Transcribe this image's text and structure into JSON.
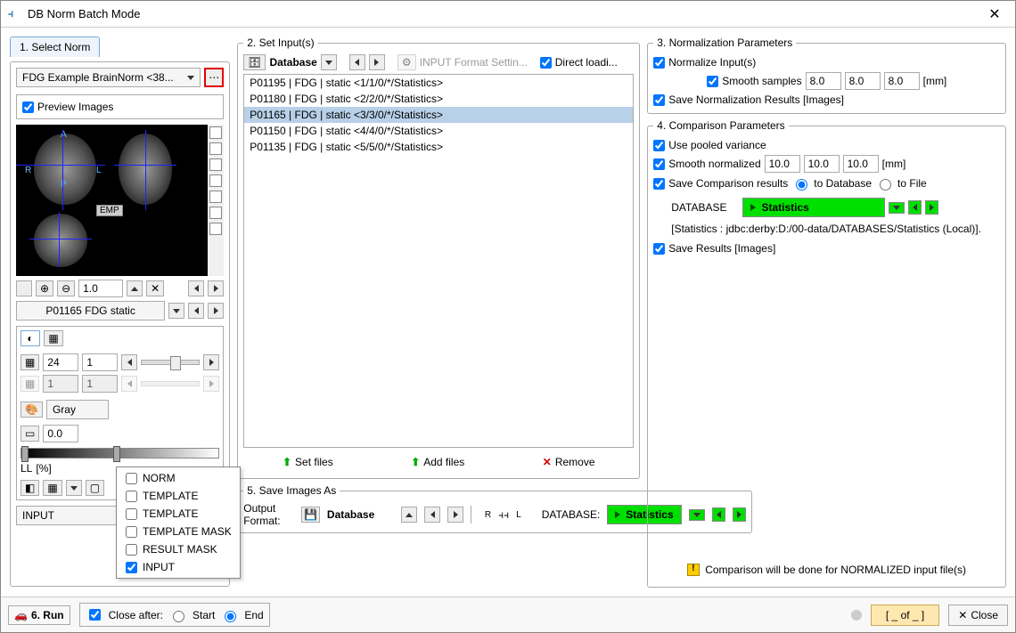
{
  "window": {
    "title": "DB Norm Batch Mode"
  },
  "sections": {
    "s1": "1. Select Norm",
    "s2": "2. Set Input(s)",
    "s3": "3. Normalization Parameters",
    "s4": "4. Comparison Parameters",
    "s5": "5. Save Images As"
  },
  "selectNorm": {
    "norm_name": "FDG Example BrainNorm <38...",
    "preview_label": "Preview Images",
    "preview_checked": true,
    "rapl": {
      "A": "A",
      "R": "R",
      "L": "L",
      "P": "P",
      "EMP": "EMP"
    },
    "zoom_value": "1.0",
    "image_name": "P01165 FDG static",
    "frame_a": "24",
    "frame_b": "1",
    "frame_c": "1",
    "frame_d": "1",
    "colormap": "Gray",
    "opacity": "0.0",
    "ll_label": "LL",
    "pct_label": "[%]",
    "input_label": "INPUT"
  },
  "popup": {
    "items": [
      {
        "label": "NORM",
        "checked": false
      },
      {
        "label": "TEMPLATE",
        "checked": false
      },
      {
        "label": "TEMPLATE",
        "checked": false
      },
      {
        "label": "TEMPLATE MASK",
        "checked": false
      },
      {
        "label": "RESULT MASK",
        "checked": false
      },
      {
        "label": "INPUT",
        "checked": true
      }
    ]
  },
  "setInputs": {
    "database_label": "Database",
    "format_btn": "INPUT Format Settin...",
    "direct_loading": "Direct loadi...",
    "list": [
      "P01195 | FDG | static <1/1/0/*/Statistics>",
      "P01180 | FDG | static <2/2/0/*/Statistics>",
      "P01165 | FDG | static <3/3/0/*/Statistics>",
      "P01150 | FDG | static <4/4/0/*/Statistics>",
      "P01135 | FDG | static <5/5/0/*/Statistics>"
    ],
    "selected_index": 2,
    "set_files": "Set files",
    "add_files": "Add files",
    "remove": "Remove"
  },
  "normParams": {
    "normalize_inputs": "Normalize Input(s)",
    "smooth_samples": "Smooth samples",
    "s1": "8.0",
    "s2": "8.0",
    "s3": "8.0",
    "unit": "[mm]",
    "save_norm": "Save Normalization Results [Images]"
  },
  "compParams": {
    "pooled": "Use pooled variance",
    "smooth_norm": "Smooth normalized",
    "n1": "10.0",
    "n2": "10.0",
    "n3": "10.0",
    "unit": "[mm]",
    "save_comp": "Save Comparison results",
    "to_db": "to Database",
    "to_file": "to File",
    "db_label": "DATABASE",
    "stats_btn": "Statistics",
    "db_path": "[Statistics : jdbc:derby:D:/00-data/DATABASES/Statistics (Local)].",
    "save_results": "Save Results [Images]",
    "warning": "Comparison will be done for NORMALIZED input file(s)"
  },
  "saveAs": {
    "output_format": "Output Format:",
    "database": "Database",
    "db_label": "DATABASE:",
    "stats_btn": "Statistics",
    "rl_label": "R"
  },
  "footer": {
    "run_label": "6. Run",
    "close_after": "Close after:",
    "start": "Start",
    "end": "End",
    "of_label": "[ _ of _ ]",
    "close": "Close"
  }
}
